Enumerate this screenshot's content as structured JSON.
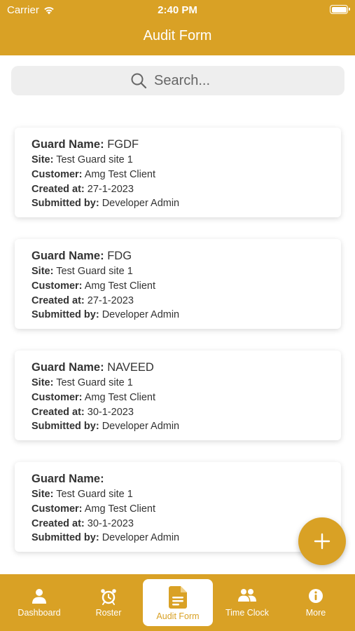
{
  "status": {
    "carrier": "Carrier",
    "time": "2:40 PM"
  },
  "header": {
    "title": "Audit Form"
  },
  "search": {
    "placeholder": "Search..."
  },
  "labels": {
    "guard_name": "Guard Name:",
    "site": "Site:",
    "customer": "Customer:",
    "created_at": "Created at:",
    "submitted_by": "Submitted by:"
  },
  "cards": [
    {
      "guard_name": "FGDF",
      "site": "Test Guard site 1",
      "customer": "Amg Test Client",
      "created_at": "27-1-2023",
      "submitted_by": "Developer Admin"
    },
    {
      "guard_name": "FDG",
      "site": "Test Guard site 1",
      "customer": "Amg Test Client",
      "created_at": "27-1-2023",
      "submitted_by": "Developer Admin"
    },
    {
      "guard_name": "NAVEED",
      "site": "Test Guard site 1",
      "customer": "Amg Test Client",
      "created_at": "30-1-2023",
      "submitted_by": "Developer Admin"
    },
    {
      "guard_name": "",
      "site": "Test Guard site 1",
      "customer": "Amg Test Client",
      "created_at": "30-1-2023",
      "submitted_by": "Developer Admin"
    }
  ],
  "fab": {
    "icon": "plus-icon"
  },
  "tabs": [
    {
      "label": "Dashboard",
      "icon": "person-icon",
      "active": false
    },
    {
      "label": "Roster",
      "icon": "alarm-clock-icon",
      "active": false
    },
    {
      "label": "Audit Form",
      "icon": "document-icon",
      "active": true
    },
    {
      "label": "Time Clock",
      "icon": "people-icon",
      "active": false
    },
    {
      "label": "More",
      "icon": "info-icon",
      "active": false
    }
  ],
  "colors": {
    "accent": "#D9A125",
    "search_bg": "#EEEEEE",
    "text": "#333333"
  }
}
